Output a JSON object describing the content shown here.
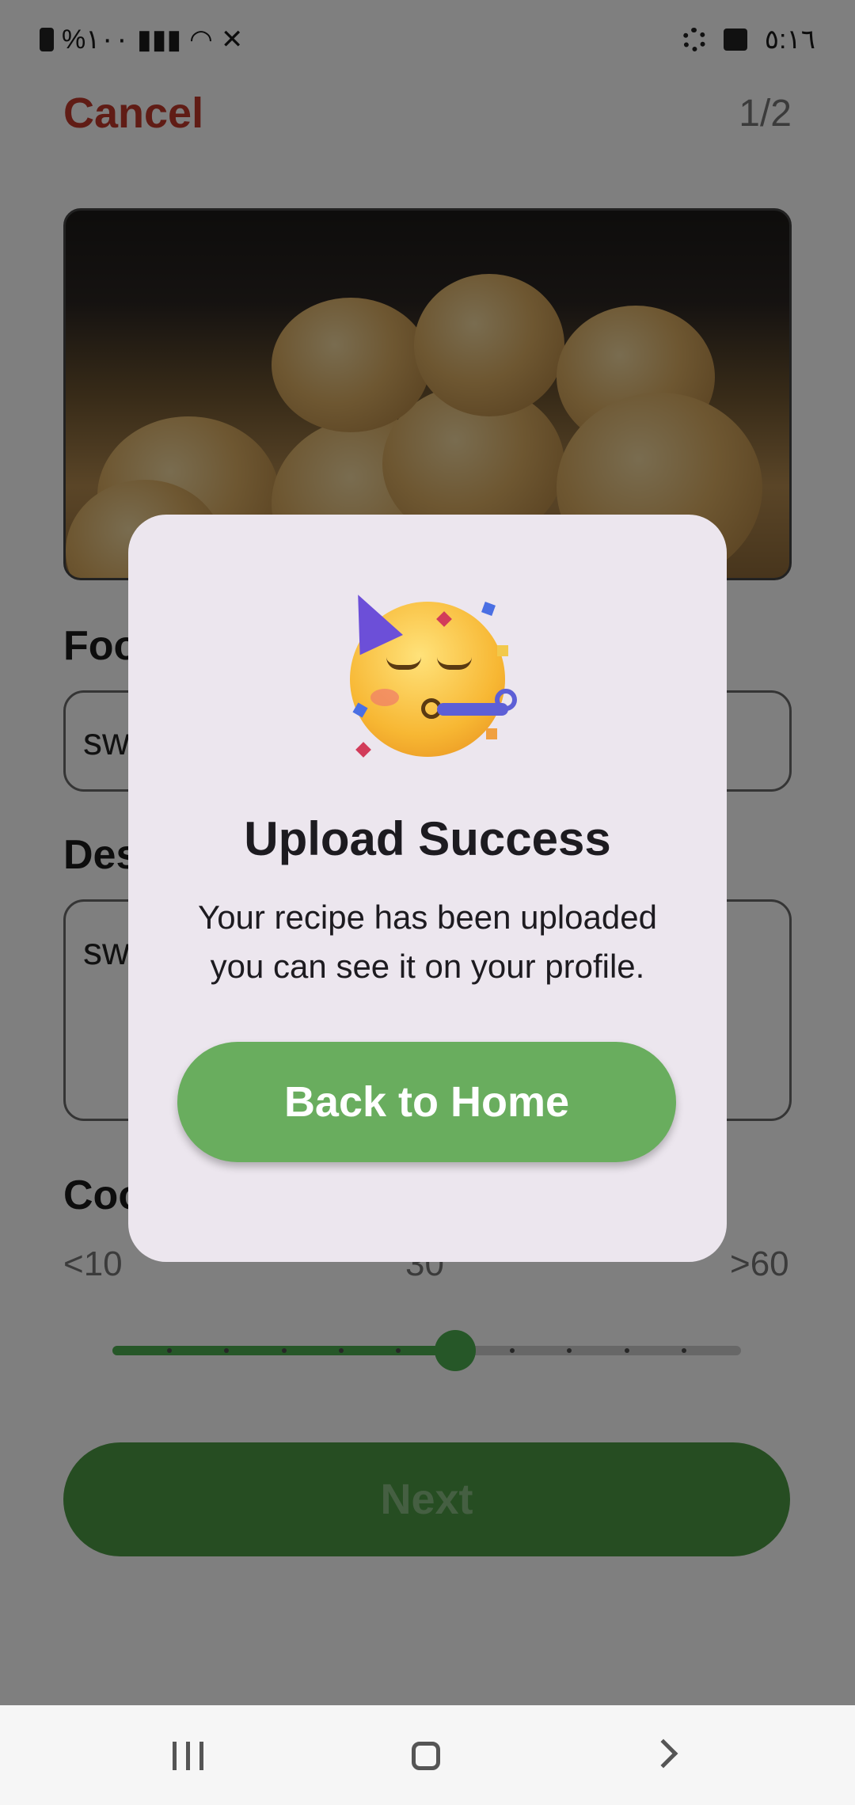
{
  "status_bar": {
    "left_text": "%١٠٠",
    "time": "٥:١٦"
  },
  "header": {
    "cancel_label": "Cancel",
    "step": "1/2"
  },
  "form": {
    "food_label": "Food Name",
    "food_value": "sweet bread",
    "description_label": "Description",
    "description_value": "sweet bread",
    "cook_label": "Cooking Duration",
    "slider_ticks": [
      "<10",
      "30",
      ">60"
    ],
    "slider_value_fraction": 0.545,
    "next_label": "Next"
  },
  "modal": {
    "emoji": "🥳",
    "title": "Upload Success",
    "message_line1": "Your recipe has been uploaded",
    "message_line2": "you can see it on your profile.",
    "button_label": "Back to Home"
  },
  "colors": {
    "accent_green": "#69ad5e",
    "cancel_red": "#c0392b",
    "modal_bg": "#ece6ee"
  }
}
